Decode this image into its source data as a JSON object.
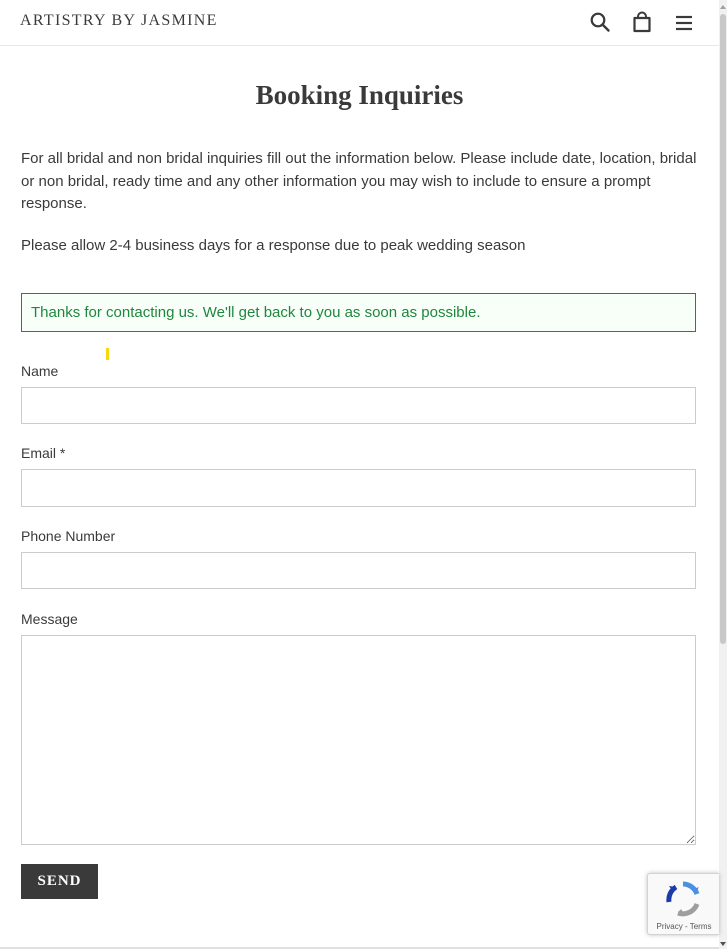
{
  "header": {
    "logo": "ARTISTRY BY JASMINE",
    "icons": [
      "search-icon",
      "cart-icon",
      "menu-icon"
    ]
  },
  "page": {
    "title": "Booking Inquiries",
    "intro": "For all bridal and non bridal inquiries fill out the information below. Please include date, location, bridal or non bridal, ready time and any other information you may wish to include to ensure a prompt response.",
    "notice": "Please allow 2-4 business days for a response due to peak wedding season",
    "success_message": "Thanks for contacting us. We'll get back to you as soon as possible."
  },
  "form": {
    "name_label": "Name",
    "name_value": "",
    "email_label": "Email *",
    "email_value": "",
    "phone_label": "Phone Number",
    "phone_value": "",
    "message_label": "Message",
    "message_value": "",
    "send_label": "SEND"
  },
  "recaptcha": {
    "privacy": "Privacy",
    "separator": " - ",
    "terms": "Terms"
  },
  "colors": {
    "text": "#3a3a3a",
    "success": "#1f873d",
    "button": "#3a3a3a"
  }
}
